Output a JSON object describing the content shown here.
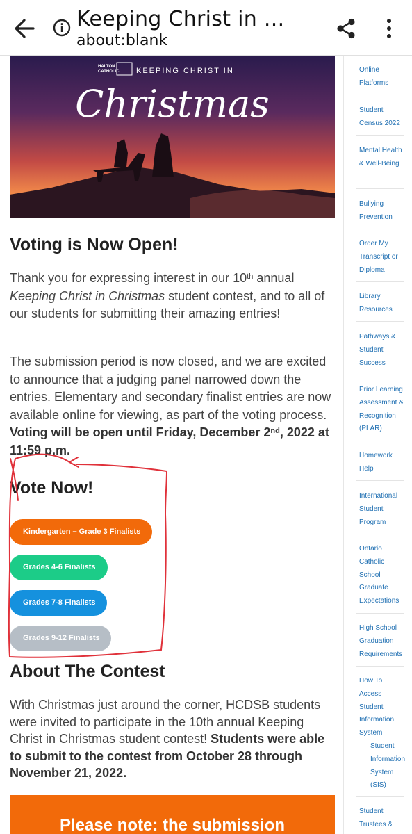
{
  "appbar": {
    "title": "Keeping Christ in ...",
    "url": "about:blank"
  },
  "icons": {
    "back": "arrow-left-icon",
    "info": "info-icon",
    "share": "share-icon",
    "more": "more-vert-icon"
  },
  "hero": {
    "brand_line1": "HALTON",
    "brand_line2": "CATHOLIC",
    "banner_text": "KEEPING CHRIST IN",
    "script_text": "Christmas"
  },
  "voting": {
    "heading": "Voting is Now Open!",
    "p1_a": "Thank you for expressing interest in our ",
    "p1_num": "10",
    "p1_sup": "th",
    "p1_b": " annual ",
    "p1_em": "Keeping Christ in Christmas",
    "p1_c": " student contest, and to all of our students for submitting their amazing entries!",
    "p2_a": "The submission period is now closed, and we are excited to announce that a judging panel narrowed down the entries. Elementary and secondary finalist entries are now available online for viewing, as part of the voting process. ",
    "p2_b1": "Voting will be open until Friday, December 2",
    "p2_sup": "nd",
    "p2_b2": ", 2022 at 11:59 p.m."
  },
  "vote": {
    "heading": "Vote Now!",
    "buttons": [
      {
        "label": "Kindergarten – Grade 3 Finalists",
        "color": "#f26a0a"
      },
      {
        "label": "Grades 4-6 Finalists",
        "color": "#1ccc88"
      },
      {
        "label": "Grades 7-8 Finalists",
        "color": "#1591de"
      },
      {
        "label": "Grades 9-12 Finalists",
        "color": "#b6bec6"
      }
    ]
  },
  "about": {
    "heading": "About The Contest",
    "p_a": "With Christmas just around the corner, HCDSB students were invited to participate in the 10th annual Keeping Christ in Christmas student contest! ",
    "p_b": "Students were able to submit to the contest from October 28 through November 21, 2022."
  },
  "note": {
    "text": "Please note: the submission"
  },
  "sidebar": {
    "items": [
      {
        "label": "Online Platforms"
      },
      {
        "label": "Student Census 2022"
      },
      {
        "label": "Mental Health & Well-Being"
      },
      {
        "label": "Bullying Prevention"
      },
      {
        "label": "Order My Transcript or Diploma"
      },
      {
        "label": "Library Resources"
      },
      {
        "label": "Pathways & Student Success"
      },
      {
        "label": "Prior Learning Assessment & Recognition (PLAR)"
      },
      {
        "label": "Homework Help"
      },
      {
        "label": "International Student Program"
      },
      {
        "label": "Ontario Catholic School Graduate Expectations"
      },
      {
        "label": "High School Graduation Requirements"
      },
      {
        "label": "How To Access Student Information System"
      },
      {
        "label": "Student Information System (SIS)"
      },
      {
        "label": "Student Trustees &"
      }
    ]
  },
  "colors": {
    "accent_orange": "#f26a0a",
    "link_blue": "#1f6fb2",
    "annotation_red": "#e0313a"
  }
}
